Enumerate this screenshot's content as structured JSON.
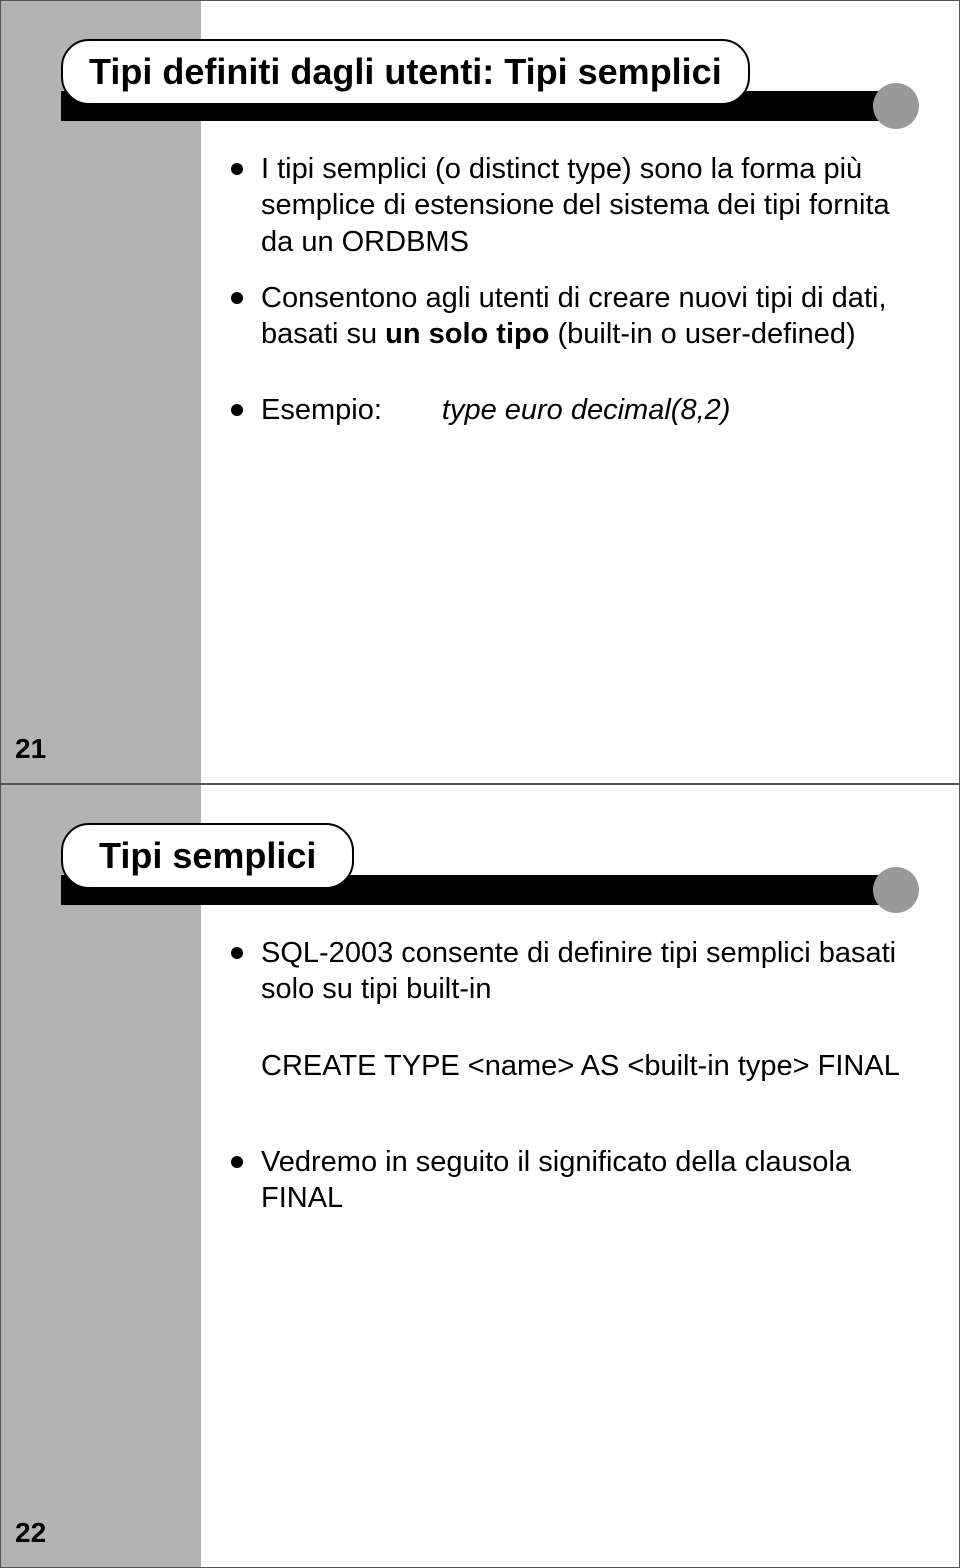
{
  "slide1": {
    "title": "Tipi definiti dagli utenti: Tipi semplici",
    "bullets": [
      "I tipi semplici (o distinct type) sono la forma più semplice di estensione del sistema dei tipi fornita da un ORDBMS",
      "Consentono agli utenti di creare nuovi tipi di dati, basati su un solo tipo (built-in o user-defined)"
    ],
    "example_label": "Esempio:",
    "example_value": "type euro decimal(8,2)",
    "page_num": "21"
  },
  "slide2": {
    "title": "Tipi semplici",
    "bullets": [
      "SQL-2003 consente di definire tipi semplici basati solo su tipi built-in"
    ],
    "code": "CREATE TYPE <name> AS <built-in type> FINAL",
    "bullets2": [
      "Vedremo in seguito il significato della clausola FINAL"
    ],
    "page_num": "22"
  }
}
